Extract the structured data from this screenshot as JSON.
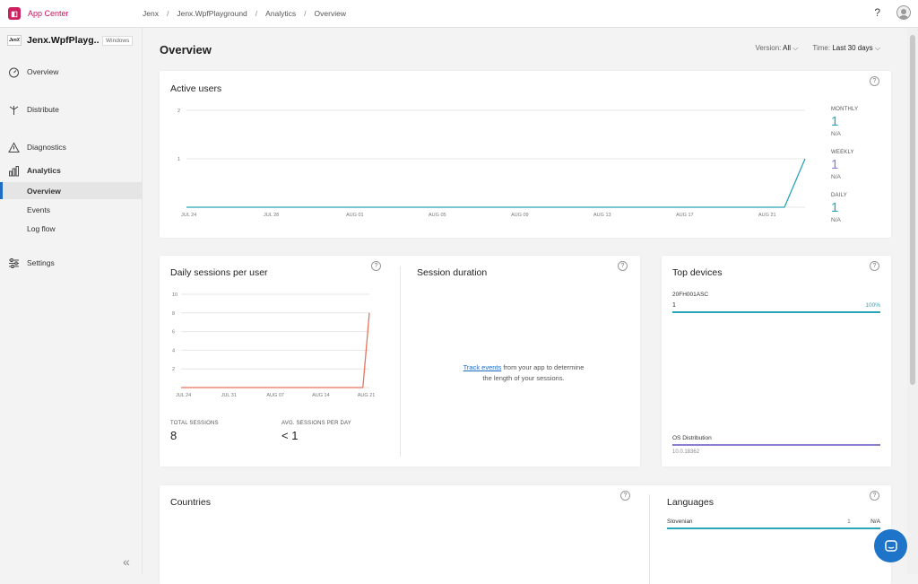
{
  "brand": {
    "name": "App Center"
  },
  "breadcrumb": [
    "Jenx",
    "Jenx.WpfPlayground",
    "Analytics",
    "Overview"
  ],
  "topbar": {
    "help_label": "?"
  },
  "app": {
    "icon_text": "JenX",
    "name": "Jenx.WpfPlayg...",
    "os": "Windows"
  },
  "nav": {
    "overview": "Overview",
    "distribute": "Distribute",
    "diagnostics": "Diagnostics",
    "analytics": "Analytics",
    "sub": [
      "Overview",
      "Events",
      "Log flow"
    ],
    "settings": "Settings"
  },
  "page": {
    "title": "Overview"
  },
  "filters": {
    "version_label": "Version:",
    "version_value": "All",
    "time_label": "Time:",
    "time_value": "Last 30 days"
  },
  "active_users": {
    "title": "Active users",
    "monthly_label": "MONTHLY",
    "monthly_value": "1",
    "monthly_na": "N/A",
    "weekly_label": "WEEKLY",
    "weekly_value": "1",
    "weekly_na": "N/A",
    "daily_label": "DAILY",
    "daily_value": "1",
    "daily_na": "N/A"
  },
  "daily_sessions": {
    "title": "Daily sessions per user",
    "total_label": "TOTAL SESSIONS",
    "total_value": "8",
    "avg_label": "AVG. SESSIONS PER DAY",
    "avg_value": "< 1"
  },
  "session_duration": {
    "title": "Session duration",
    "link": "Track events",
    "text1": " from your app to determine",
    "text2": "the length of your sessions."
  },
  "top_devices": {
    "title": "Top devices",
    "device_name": "20FH001ASC",
    "device_count": "1",
    "device_pct": "100%",
    "os_label": "OS Distribution",
    "os_version": "10.0.18362"
  },
  "countries": {
    "title": "Countries"
  },
  "languages": {
    "title": "Languages",
    "lang": "Slovenian",
    "count": "1",
    "pct": "N/A"
  },
  "colors": {
    "accent": "#2aa4b8",
    "brand": "#c4155f",
    "session_line": "#e8735c",
    "os_bar": "#8a7fd0"
  },
  "chart_data": [
    {
      "type": "line",
      "x": [
        "JUL 24",
        "JUL 25",
        "JUL 26",
        "JUL 27",
        "JUL 28",
        "JUL 29",
        "JUL 30",
        "JUL 31",
        "AUG 01",
        "AUG 02",
        "AUG 03",
        "AUG 04",
        "AUG 05",
        "AUG 06",
        "AUG 07",
        "AUG 08",
        "AUG 09",
        "AUG 10",
        "AUG 11",
        "AUG 12",
        "AUG 13",
        "AUG 14",
        "AUG 15",
        "AUG 16",
        "AUG 17",
        "AUG 18",
        "AUG 19",
        "AUG 20",
        "AUG 21",
        "AUG 22",
        "AUG 23"
      ],
      "xticks": [
        "JUL 24",
        "JUL 28",
        "AUG 01",
        "AUG 05",
        "AUG 09",
        "AUG 13",
        "AUG 17",
        "AUG 21"
      ],
      "series": [
        {
          "values": [
            0,
            0,
            0,
            0,
            0,
            0,
            0,
            0,
            0,
            0,
            0,
            0,
            0,
            0,
            0,
            0,
            0,
            0,
            0,
            0,
            0,
            0,
            0,
            0,
            0,
            0,
            0,
            0,
            0,
            0,
            1
          ]
        }
      ],
      "ylim": [
        0,
        2
      ],
      "yticks": [
        "2",
        "1"
      ],
      "grid": true
    },
    {
      "type": "line",
      "x": [
        "JUL 24",
        "JUL 25",
        "JUL 26",
        "JUL 27",
        "JUL 28",
        "JUL 29",
        "JUL 30",
        "JUL 31",
        "AUG 01",
        "AUG 02",
        "AUG 03",
        "AUG 04",
        "AUG 05",
        "AUG 06",
        "AUG 07",
        "AUG 08",
        "AUG 09",
        "AUG 10",
        "AUG 11",
        "AUG 12",
        "AUG 13",
        "AUG 14",
        "AUG 15",
        "AUG 16",
        "AUG 17",
        "AUG 18",
        "AUG 19",
        "AUG 20",
        "AUG 21",
        "AUG 22"
      ],
      "xticks": [
        "JUL 24",
        "JUL 31",
        "AUG 07",
        "AUG 14",
        "AUG 21"
      ],
      "series": [
        {
          "values": [
            0,
            0,
            0,
            0,
            0,
            0,
            0,
            0,
            0,
            0,
            0,
            0,
            0,
            0,
            0,
            0,
            0,
            0,
            0,
            0,
            0,
            0,
            0,
            0,
            0,
            0,
            0,
            0,
            0,
            8
          ]
        }
      ],
      "ylim": [
        0,
        10
      ],
      "yticks": [
        "10",
        "8",
        "6",
        "4",
        "2"
      ],
      "grid": true
    }
  ]
}
